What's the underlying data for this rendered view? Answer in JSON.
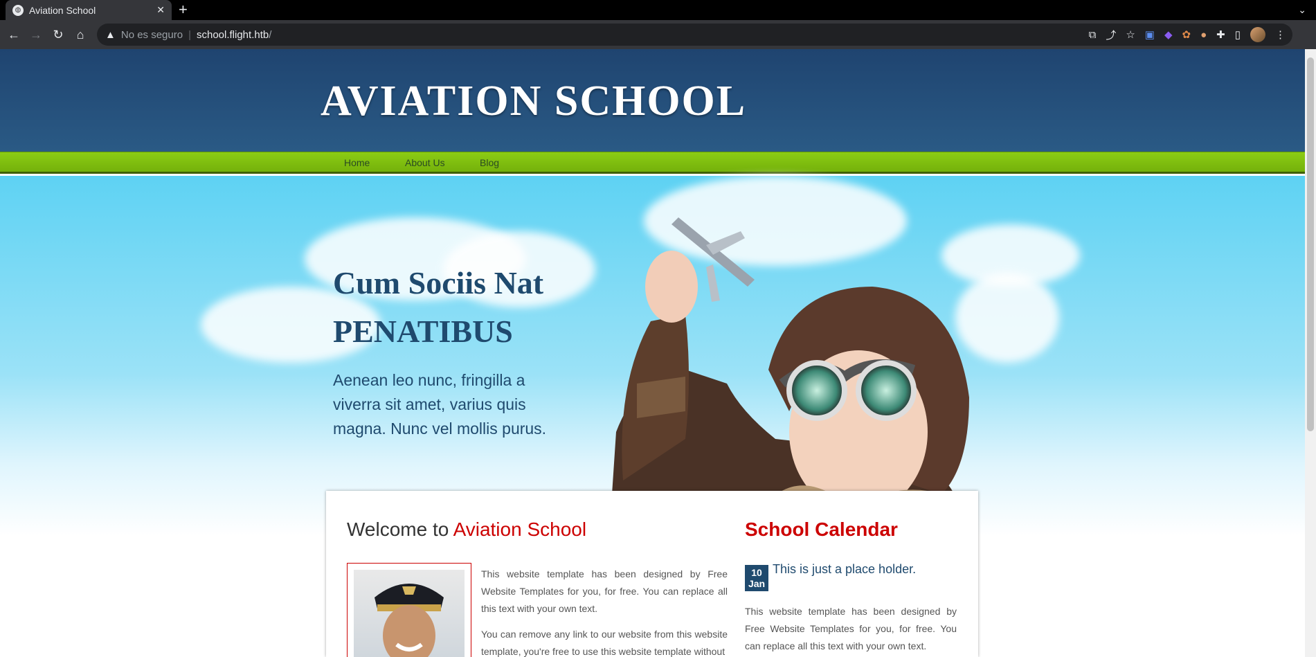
{
  "browser": {
    "tab_title": "Aviation School",
    "close_glyph": "✕",
    "new_tab_glyph": "+",
    "tab_menu_glyph": "⌄",
    "security_label": "No es seguro",
    "url_host": "school.flight.htb",
    "url_path": "/",
    "icons": [
      "back-icon",
      "forward-icon",
      "reload-icon",
      "home-icon",
      "warning-icon",
      "translate-icon",
      "share-icon",
      "star-icon",
      "extensions-icon",
      "sidebar-icon",
      "menu-icon"
    ]
  },
  "site": {
    "logo": "AVIATION SCHOOL",
    "nav": [
      {
        "label": "Home"
      },
      {
        "label": "About Us"
      },
      {
        "label": "Blog"
      }
    ],
    "hero": {
      "line1": "Cum Sociis Nat",
      "line2": "PENATIBUS",
      "text": "Aenean leo nunc, fringilla a viverra sit amet, varius quis magna. Nunc vel mollis purus."
    },
    "welcome": {
      "prefix": "Welcome to ",
      "highlight": "Aviation School",
      "p1": "This website template has been designed by Free Website Templates for you, for free. You can replace all this text with your own text.",
      "p2": "You can remove any link to our website from this website template, you're free to use this website template without"
    },
    "calendar": {
      "title": "School Calendar",
      "day": "10",
      "month": "Jan",
      "event": "This is just a place holder.",
      "text": "This website template has been designed by Free Website Templates for you, for free. You can replace all this text with your own text."
    }
  },
  "colors": {
    "header": "#1f4470",
    "nav": "#7dbd10",
    "accent_red": "#cc0000",
    "text_blue": "#1f4a6e"
  }
}
